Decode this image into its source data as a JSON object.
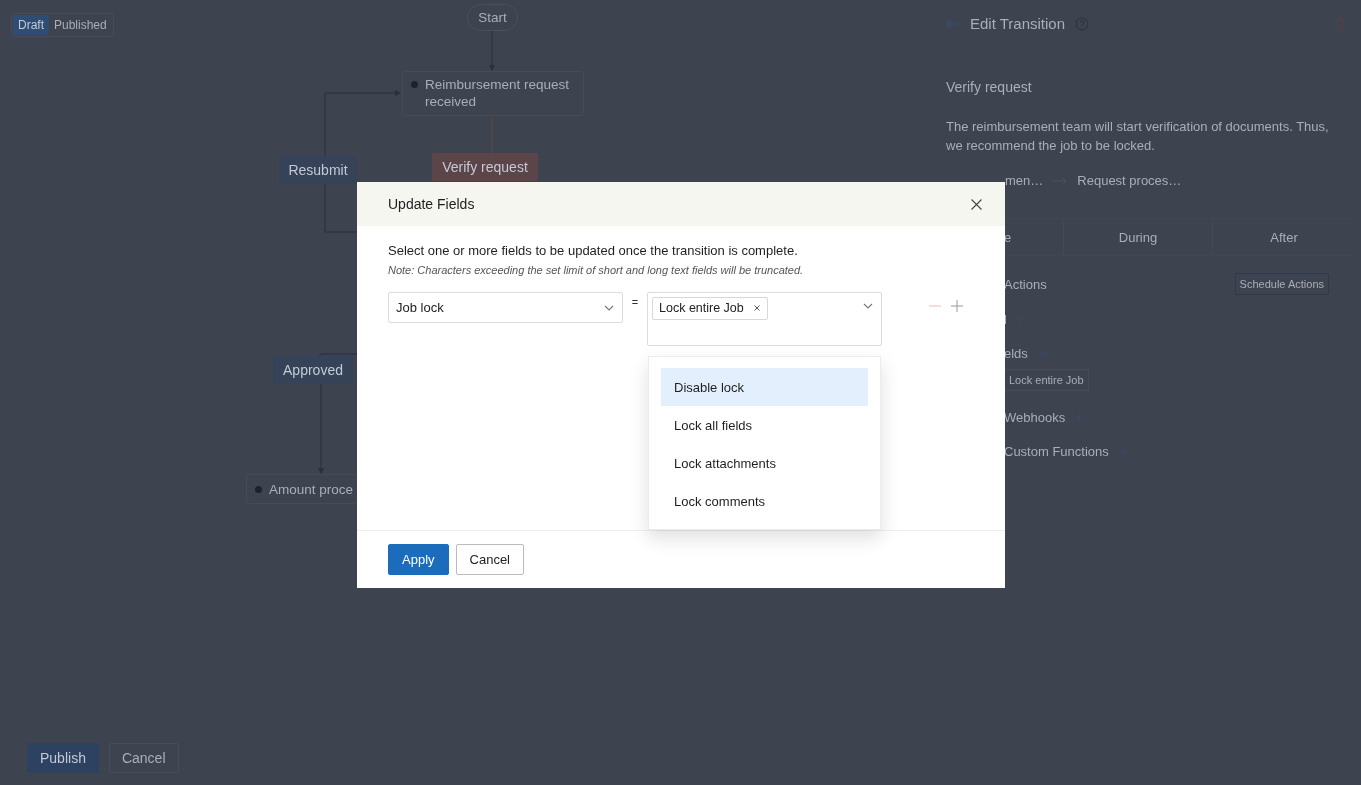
{
  "status_toggle": [
    {
      "label": "Draft",
      "selected": true
    },
    {
      "label": "Published",
      "selected": false
    }
  ],
  "diagram": {
    "nodes": [
      {
        "kind": "start",
        "label": "Start"
      },
      {
        "kind": "state",
        "label": "Reimbursement request received"
      },
      {
        "kind": "transition",
        "label": "Resubmit",
        "color": "#354257"
      },
      {
        "kind": "transition",
        "label": "Verify request",
        "color": "#5c4549"
      },
      {
        "kind": "transition",
        "label": "Approved",
        "color": "#354257"
      },
      {
        "kind": "state",
        "label": "Amount proce"
      }
    ]
  },
  "footer_buttons": [
    {
      "label": "Publish",
      "kind": "primary"
    },
    {
      "label": "Cancel",
      "kind": "secondary"
    }
  ],
  "panel": {
    "title": "Edit Transition",
    "transition_name": "Verify request",
    "description": "The reimbursement team will start verification of documents. Thus, we recommend the job to be locked.",
    "route_from": "men…",
    "route_to": "Request proces…",
    "tabs": [
      "e",
      "During",
      "After"
    ],
    "actions_heading": "Actions",
    "schedule_button": "Schedule Actions",
    "sections": [
      {
        "label": "l"
      },
      {
        "label": "elds",
        "chips": [
          "Lock entire Job"
        ]
      },
      {
        "label": "Webhooks"
      },
      {
        "label": "Custom Functions"
      }
    ]
  },
  "dialog": {
    "title": "Update Fields",
    "instruction": "Select one or more fields to be updated once the transition is complete.",
    "note": "Note: Characters exceeding the set limit of short and long text fields will be truncated.",
    "field": "Job lock",
    "operator": "=",
    "value_chips": [
      "Lock entire Job"
    ],
    "options": [
      {
        "label": "Disable lock",
        "selected": true
      },
      {
        "label": "Lock all fields",
        "selected": false
      },
      {
        "label": "Lock attachments",
        "selected": false
      },
      {
        "label": "Lock comments",
        "selected": false
      }
    ],
    "buttons": [
      {
        "label": "Apply",
        "kind": "primary"
      },
      {
        "label": "Cancel",
        "kind": "secondary"
      }
    ]
  }
}
